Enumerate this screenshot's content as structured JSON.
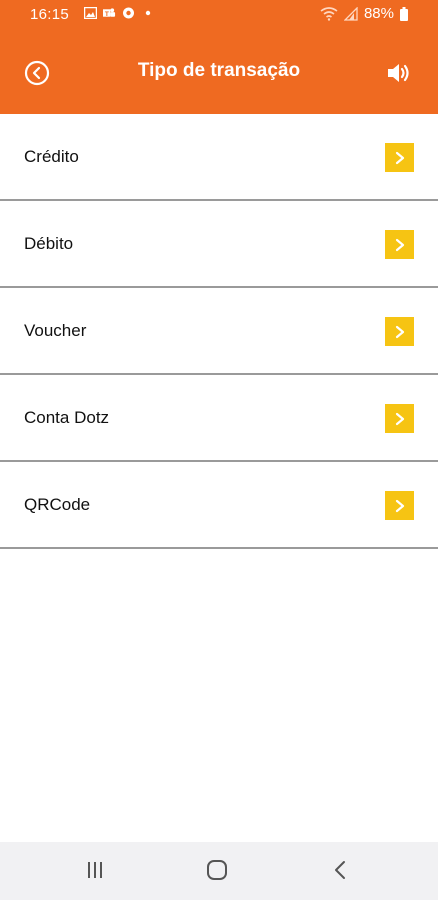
{
  "status_bar": {
    "time": "16:15",
    "battery": "88%",
    "icons": [
      "image-icon",
      "teams-icon",
      "chrome-icon",
      "dot-icon",
      "wifi-icon",
      "signal-icon",
      "battery-icon"
    ]
  },
  "header": {
    "title": "Tipo de transação",
    "back_icon": "back-circle-icon",
    "sound_icon": "speaker-icon",
    "color": "#ef6a21"
  },
  "transaction_types": [
    {
      "label": "Crédito"
    },
    {
      "label": "Débito"
    },
    {
      "label": "Voucher"
    },
    {
      "label": "Conta Dotz"
    },
    {
      "label": "QRCode"
    }
  ],
  "accent": "#f6c413",
  "nav_bar": {
    "buttons": [
      "recents-icon",
      "home-icon",
      "back-icon"
    ]
  }
}
